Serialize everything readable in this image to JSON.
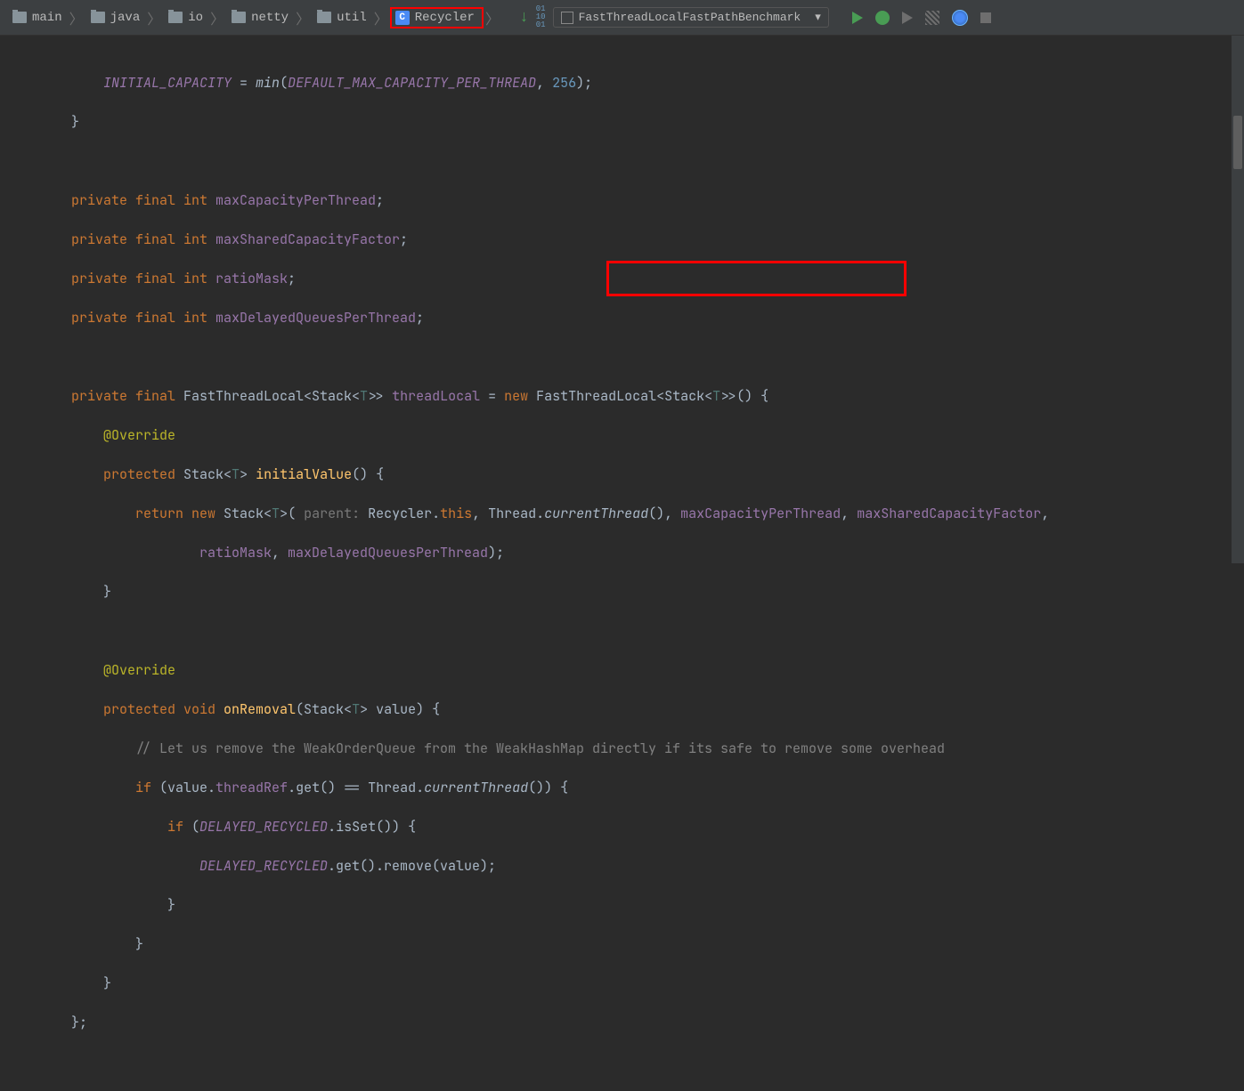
{
  "breadcrumbs": {
    "main": "main",
    "java": "java",
    "io": "io",
    "netty": "netty",
    "util": "util",
    "recycler": "Recycler",
    "classIconLetter": "C"
  },
  "runConfig": {
    "label": "FastThreadLocalFastPathBenchmark"
  },
  "binaryGlyph": "01\n10\n01",
  "code": {
    "l1_a": "INITIAL_CAPACITY",
    "l1_b": " = ",
    "l1_c": "min",
    "l1_d": "(",
    "l1_e": "DEFAULT_MAX_CAPACITY_PER_THREAD",
    "l1_f": ", ",
    "l1_g": "256",
    "l1_h": ");",
    "l2": "}",
    "l4_a": "private final int ",
    "l4_b": "maxCapacityPerThread",
    "l4_c": ";",
    "l5_a": "private final int ",
    "l5_b": "maxSharedCapacityFactor",
    "l5_c": ";",
    "l6_a": "private final int ",
    "l6_b": "ratioMask",
    "l6_c": ";",
    "l7_a": "private final int ",
    "l7_b": "maxDelayedQueuesPerThread",
    "l7_c": ";",
    "l9_a": "private final ",
    "l9_b": "FastThreadLocal<Stack<",
    "l9_c": "T",
    "l9_d": ">> ",
    "l9_e": "threadLocal",
    "l9_f": " = ",
    "l9_g": "new",
    "l9_h": " FastThreadLocal<Stack<",
    "l9_i": "T",
    "l9_j": ">>() {",
    "l10": "@Override",
    "l11_a": "protected ",
    "l11_b": "Stack<",
    "l11_c": "T",
    "l11_d": "> ",
    "l11_e": "initialValue",
    "l11_f": "() {",
    "l12_a": "return new ",
    "l12_b": "Stack<",
    "l12_c": "T",
    "l12_d": ">( ",
    "l12_e": "parent: ",
    "l12_f": "Recycler.",
    "l12_g": "this",
    "l12_h": ", Thread.",
    "l12_i": "currentThread",
    "l12_j": "(), ",
    "l12_k": "maxCapacityPerThread",
    "l12_l": ", ",
    "l12_m": "maxSharedCapacityFactor",
    "l12_n": ",",
    "l13_a": "ratioMask",
    "l13_b": ", ",
    "l13_c": "maxDelayedQueuesPerThread",
    "l13_d": ");",
    "l14": "}",
    "l16": "@Override",
    "l17_a": "protected void ",
    "l17_b": "onRemoval",
    "l17_c": "(Stack<",
    "l17_d": "T",
    "l17_e": "> value) {",
    "l18": "// Let us remove the WeakOrderQueue from the WeakHashMap directly if its safe to remove some overhead",
    "l19_a": "if ",
    "l19_b": "(value.",
    "l19_c": "threadRef",
    "l19_d": ".get() == Thread.",
    "l19_e": "currentThread",
    "l19_f": "()) {",
    "l20_a": "if ",
    "l20_b": "(",
    "l20_c": "DELAYED_RECYCLED",
    "l20_d": ".isSet()) {",
    "l21_a": "DELAYED_RECYCLED",
    "l21_b": ".get().remove(value);",
    "l22": "}",
    "l23": "}",
    "l24": "}",
    "l25": "};"
  }
}
